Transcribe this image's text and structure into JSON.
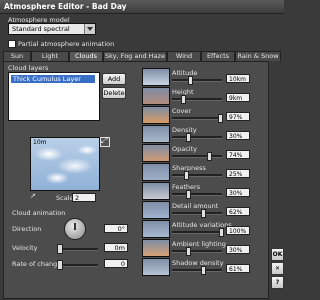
{
  "window": {
    "title": "Atmosphere Editor - Bad Day"
  },
  "atmosphere": {
    "model_label": "Atmosphere model",
    "model_value": "Standard spectral",
    "partial_label": "Partial atmosphere animation"
  },
  "tabs": [
    "Sun",
    "Light",
    "Clouds",
    "Sky, Fog and Haze",
    "Wind",
    "Effects",
    "Rain & Snow"
  ],
  "active_tab": "Clouds",
  "layers": {
    "label": "Cloud layers",
    "items": [
      "Thick Cumulus Layer"
    ],
    "add": "Add",
    "delete": "Delete"
  },
  "preview": {
    "dimension": "10m",
    "scale_label": "Scale",
    "scale_value": "2"
  },
  "animation": {
    "label": "Cloud animation",
    "direction_label": "Direction",
    "direction_value": "0°",
    "velocity_label": "Velocity",
    "velocity_value": "0m",
    "rate_label": "Rate of change",
    "rate_value": "0"
  },
  "params": [
    {
      "name": "Altitude",
      "value": "10km",
      "level": 0.35,
      "thumb_color": "#c9d6e4"
    },
    {
      "name": "Height",
      "value": "9km",
      "level": 0.2,
      "thumb_color": "#b28b7c"
    },
    {
      "name": "Cover",
      "value": "97%",
      "level": 0.97,
      "thumb_color": "#d89a63"
    },
    {
      "name": "Density",
      "value": "30%",
      "level": 0.3,
      "thumb_color": "#a9b9cc"
    },
    {
      "name": "Opacity",
      "value": "74%",
      "level": 0.74,
      "thumb_color": "#cf9a73"
    },
    {
      "name": "Sharpness",
      "value": "25%",
      "level": 0.25,
      "thumb_color": "#9eb1c8"
    },
    {
      "name": "Feathers",
      "value": "30%",
      "level": 0.3,
      "thumb_color": "#c7cbd3"
    },
    {
      "name": "Detail amount",
      "value": "62%",
      "level": 0.62,
      "thumb_color": "#9fb4cf"
    },
    {
      "name": "Altitude variations",
      "value": "100%",
      "level": 1.0,
      "thumb_color": "#a7b9d1"
    },
    {
      "name": "Ambient lighting",
      "value": "30%",
      "level": 0.3,
      "thumb_color": "#d6a175"
    },
    {
      "name": "Shadow density",
      "value": "61%",
      "level": 0.61,
      "thumb_color": "#b6c4d6"
    }
  ],
  "side_buttons": [
    "OK",
    "✕",
    "?"
  ]
}
